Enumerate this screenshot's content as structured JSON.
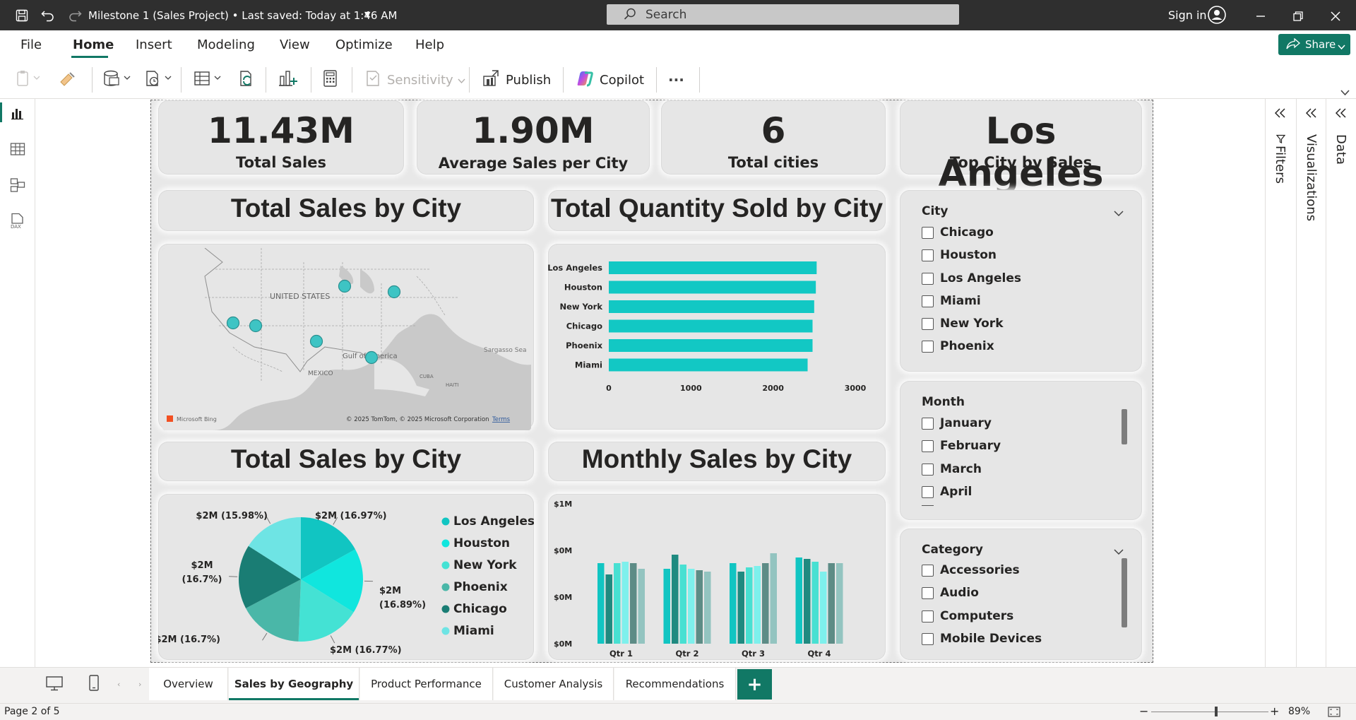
{
  "titlebar": {
    "doc_title": "Milestone 1 (Sales Project)  •  Last saved: Today at 1:46 AM",
    "search_placeholder": "Search",
    "signin": "Sign in"
  },
  "menu": {
    "items": [
      "File",
      "Home",
      "Insert",
      "Modeling",
      "View",
      "Optimize",
      "Help"
    ],
    "active": "Home",
    "share_label": "Share"
  },
  "ribbon": {
    "sensitivity": "Sensitivity",
    "publish": "Publish",
    "copilot": "Copilot",
    "more": "···"
  },
  "kpis": [
    {
      "value": "11.43M",
      "label": "Total Sales"
    },
    {
      "value": "1.90M",
      "label": "Average Sales per City"
    },
    {
      "value": "6",
      "label": "Total cities"
    },
    {
      "value": "Los Angeles",
      "label": "Top City by Sales"
    }
  ],
  "titles": {
    "map": "Total Sales by City",
    "bar": "Total Quantity Sold by City",
    "pie": "Total Sales by City",
    "column": "Monthly Sales by City"
  },
  "map": {
    "country_label": "UNITED STATES",
    "gulf_label": "Gulf of America",
    "mexico_label": "MEXICO",
    "sargasso_label": "Sargasso Sea",
    "cuba_label": "CUBA",
    "haiti_label": "HAITI",
    "bing_label": "Microsoft Bing",
    "copyright": "© 2025 TomTom, © 2025 Microsoft Corporation",
    "terms": "Terms",
    "bubble_color": "#3ec4c4"
  },
  "slicers": {
    "city": {
      "title": "City",
      "options": [
        "Chicago",
        "Houston",
        "Los Angeles",
        "Miami",
        "New York",
        "Phoenix"
      ]
    },
    "month": {
      "title": "Month",
      "options": [
        "January",
        "February",
        "March",
        "April"
      ]
    },
    "category": {
      "title": "Category",
      "options": [
        "Accessories",
        "Audio",
        "Computers",
        "Mobile Devices"
      ]
    }
  },
  "chart_data": [
    {
      "type": "bar",
      "orientation": "horizontal",
      "title": "Total Quantity Sold by City",
      "categories": [
        "Los Angeles",
        "Houston",
        "New York",
        "Chicago",
        "Phoenix",
        "Miami"
      ],
      "values": [
        2530,
        2520,
        2500,
        2480,
        2480,
        2420
      ],
      "xlim": [
        0,
        3000
      ],
      "xticks": [
        "0",
        "1000",
        "2000",
        "3000"
      ],
      "color": "#12c8c4",
      "grid": false
    },
    {
      "type": "pie",
      "title": "Total Sales by City",
      "categories": [
        "Los Angeles",
        "Houston",
        "New York",
        "Phoenix",
        "Chicago",
        "Miami"
      ],
      "values": [
        16.97,
        16.89,
        16.77,
        16.7,
        16.7,
        15.98
      ],
      "data_labels": [
        "$2M (16.97%)",
        "$2M (16.89%)",
        "$2M (16.77%)",
        "$2M (16.7%)",
        "$2M (16.7%)",
        "$2M (15.98%)"
      ],
      "colors": [
        "#11c5c2",
        "#10e6de",
        "#44e2d4",
        "#4ab7a8",
        "#1a7d74",
        "#6ee4e4"
      ],
      "legend": "right"
    },
    {
      "type": "bar",
      "title": "Monthly Sales by City",
      "categories": [
        "Qtr 1",
        "Qtr 2",
        "Qtr 3",
        "Qtr 4"
      ],
      "yticks": [
        "$1M",
        "$0M",
        "$0M",
        "$0M"
      ],
      "ylim": [
        0,
        1.0
      ],
      "series": [
        {
          "values": [
            0.57,
            0.53,
            0.57,
            0.61
          ],
          "color": "#11c5c2"
        },
        {
          "values": [
            0.49,
            0.63,
            0.51,
            0.6
          ],
          "color": "#1f8a80"
        },
        {
          "values": [
            0.57,
            0.56,
            0.54,
            0.58
          ],
          "color": "#48e0d2"
        },
        {
          "values": [
            0.58,
            0.53,
            0.55,
            0.51
          ],
          "color": "#7ef0ec"
        },
        {
          "values": [
            0.57,
            0.52,
            0.57,
            0.57
          ],
          "color": "#5d8c86"
        },
        {
          "values": [
            0.53,
            0.51,
            0.64,
            0.57
          ],
          "color": "#93c4c0"
        }
      ],
      "legend": "none"
    }
  ],
  "page_tabs": [
    "Overview",
    "Sales by Geography",
    "Product Performance",
    "Customer Analysis",
    "Recommendations"
  ],
  "active_tab": "Sales by Geography",
  "add_page": "+",
  "panes": {
    "filters": "Filters",
    "visualizations": "Visualizations",
    "data": "Data"
  },
  "status": {
    "page": "Page 2 of 5",
    "zoom": "89%"
  }
}
